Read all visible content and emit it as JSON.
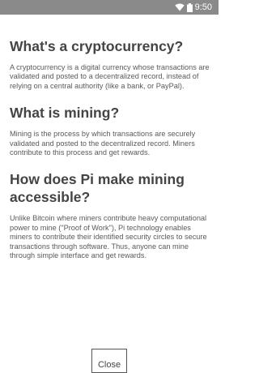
{
  "status_bar": {
    "time": "9:50",
    "icons": [
      "wifi-icon",
      "battery-icon"
    ]
  },
  "sections": [
    {
      "heading": "What's a cryptocurrency?",
      "body": "A cryptocurrency is a digital currency whose transactions are validated and posted to a decentralized record, instead of relying on a central authority (like a bank, or PayPal)."
    },
    {
      "heading": "What is mining?",
      "body": "Mining is the process by which transactions are securely validated and posted to the decentralized record. Miners contribute to this process and get rewards."
    },
    {
      "heading": "How does Pi make mining accessible?",
      "body": "Unlike Bitcoin where miners contribute heavy computational power to mine (\"Proof of Work\"), Pi technology enables miners to contribute their identified security circles to secure transactions through software. Thus, anyone can mine through simple interface and get rewards."
    }
  ],
  "close_button": {
    "label": "Close"
  }
}
